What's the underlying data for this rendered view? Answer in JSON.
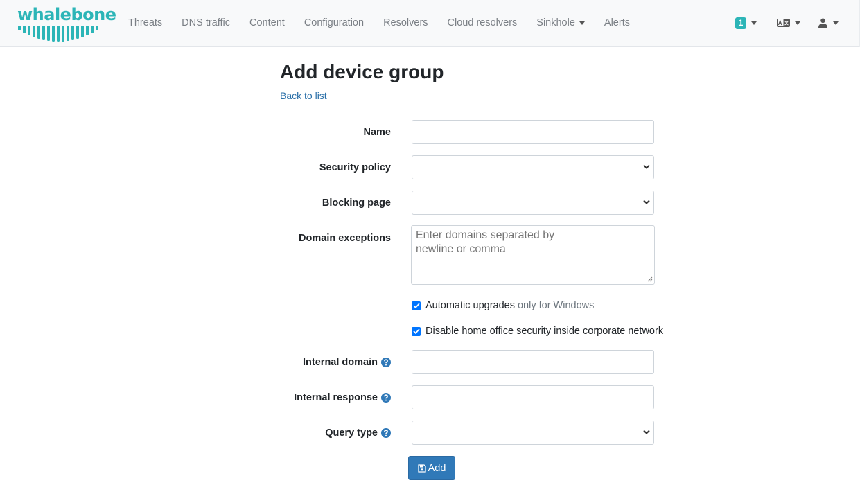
{
  "brand": {
    "name": "whalebone",
    "color": "#2cb5b7"
  },
  "nav": {
    "links": [
      "Threats",
      "DNS traffic",
      "Content",
      "Configuration",
      "Resolvers",
      "Cloud resolvers",
      "Sinkhole",
      "Alerts"
    ],
    "notifications_count": "1",
    "language_icon": "translate-icon",
    "user_icon": "user-icon"
  },
  "page": {
    "title": "Add device group",
    "back_link": "Back to list"
  },
  "form": {
    "name_label": "Name",
    "name_value": "",
    "security_policy_label": "Security policy",
    "security_policy_value": "",
    "blocking_page_label": "Blocking page",
    "blocking_page_value": "",
    "domain_exceptions_label": "Domain exceptions",
    "domain_exceptions_placeholder": "Enter domains separated by\nnewline or comma",
    "auto_upgrades_label": "Automatic upgrades",
    "auto_upgrades_note": "only for Windows",
    "auto_upgrades_checked": true,
    "disable_home_office_label": "Disable home office security inside corporate network",
    "disable_home_office_checked": true,
    "internal_domain_label": "Internal domain",
    "internal_domain_value": "",
    "internal_response_label": "Internal response",
    "internal_response_value": "",
    "query_type_label": "Query type",
    "query_type_value": "",
    "submit_label": "Add"
  },
  "colors": {
    "accent": "#2cb5b7",
    "primary_button": "#3079b8",
    "link": "#2a6fa8",
    "checkbox": "#0075ff"
  }
}
